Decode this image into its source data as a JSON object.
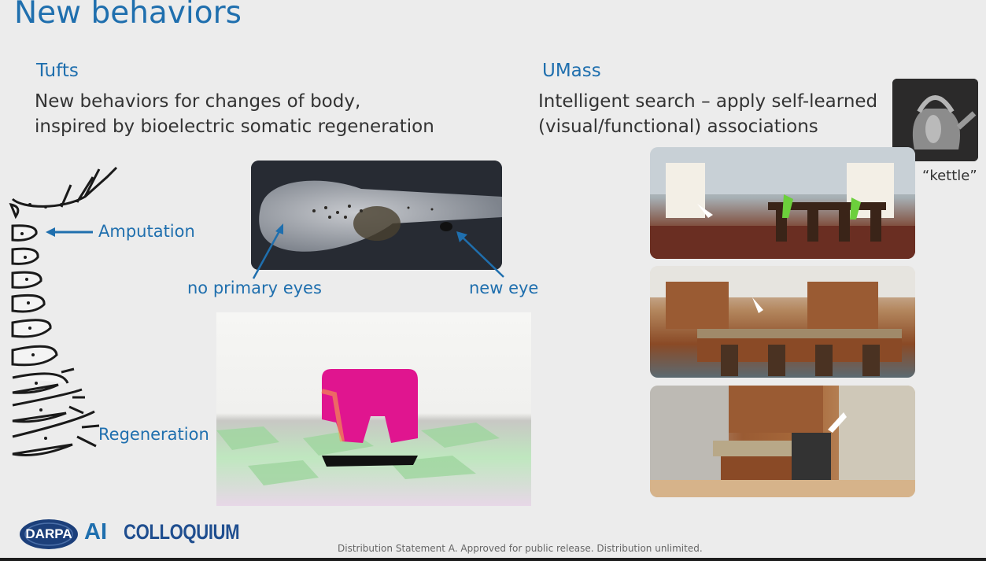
{
  "slide": {
    "title": "New behaviors"
  },
  "left": {
    "heading": "Tufts",
    "subtitle_line1": "New behaviors for changes of body,",
    "subtitle_line2": "inspired by bioelectric somatic regeneration",
    "amputation_label": "Amputation",
    "regeneration_label": "Regeneration",
    "no_primary_eyes_label": "no primary eyes",
    "new_eye_label": "new eye"
  },
  "right": {
    "heading": "UMass",
    "subtitle_line1": "Intelligent search – apply self-learned",
    "subtitle_line2": "(visual/functional) associations",
    "kettle_caption": "“kettle”"
  },
  "footer": {
    "darpa": "DARPA",
    "ai": "AI",
    "colloquium": "COLLOQUIUM",
    "distribution": "Distribution Statement A. Approved for public release. Distribution unlimited."
  },
  "colors": {
    "accent_blue": "#1f6fae",
    "text_dark": "#333333",
    "background": "#ececec",
    "magenta_block": "#e0158f"
  },
  "icons": [
    "arrow-left-icon",
    "arrow-pointer-icon"
  ]
}
